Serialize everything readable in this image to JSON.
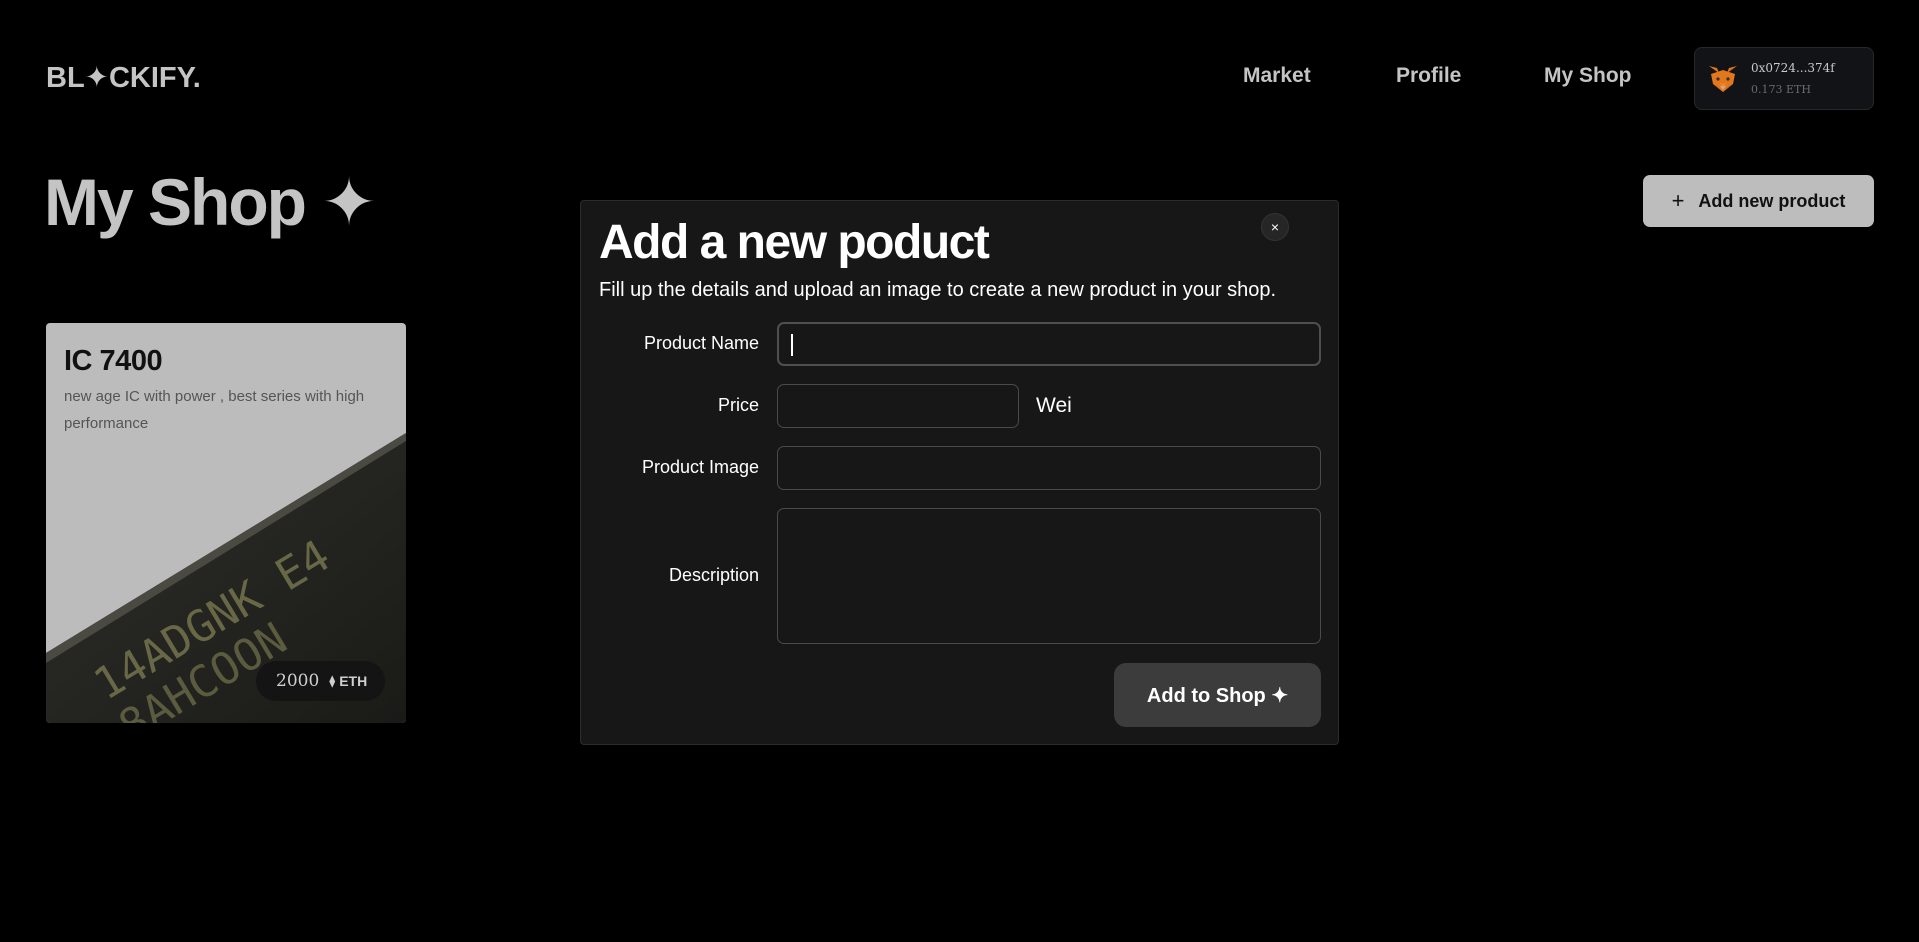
{
  "header": {
    "logo": "BL✦CKIFY.",
    "nav": [
      {
        "label": "Market"
      },
      {
        "label": "Profile"
      },
      {
        "label": "My Shop"
      }
    ],
    "wallet": {
      "icon": "metamask-fox-icon",
      "address": "0x0724...374f",
      "balance": "0.173 ETH"
    }
  },
  "page": {
    "title": "My Shop ✦",
    "add_button_label": "Add new product",
    "add_button_icon": "plus-icon"
  },
  "products": [
    {
      "name": "IC 7400",
      "description": "new age IC with power , best series with high performance",
      "price": "2000",
      "unit": "ETH",
      "unit_icon": "ethereum-icon"
    }
  ],
  "modal": {
    "title": "Add a new poduct",
    "subtitle": "Fill up the details and upload an image to create a new product in your shop.",
    "close_label": "×",
    "fields": {
      "name_label": "Product Name",
      "name_value": "",
      "price_label": "Price",
      "price_value": "",
      "price_unit": "Wei",
      "image_label": "Product Image",
      "image_value": "",
      "description_label": "Description",
      "description_value": ""
    },
    "submit_label": "Add to Shop ✦"
  },
  "colors": {
    "background": "#000000",
    "muted_text": "#c4c4c4",
    "modal_bg": "#171717",
    "primary_button": "#bdbdbd",
    "submit_button": "#3c3c3c"
  }
}
